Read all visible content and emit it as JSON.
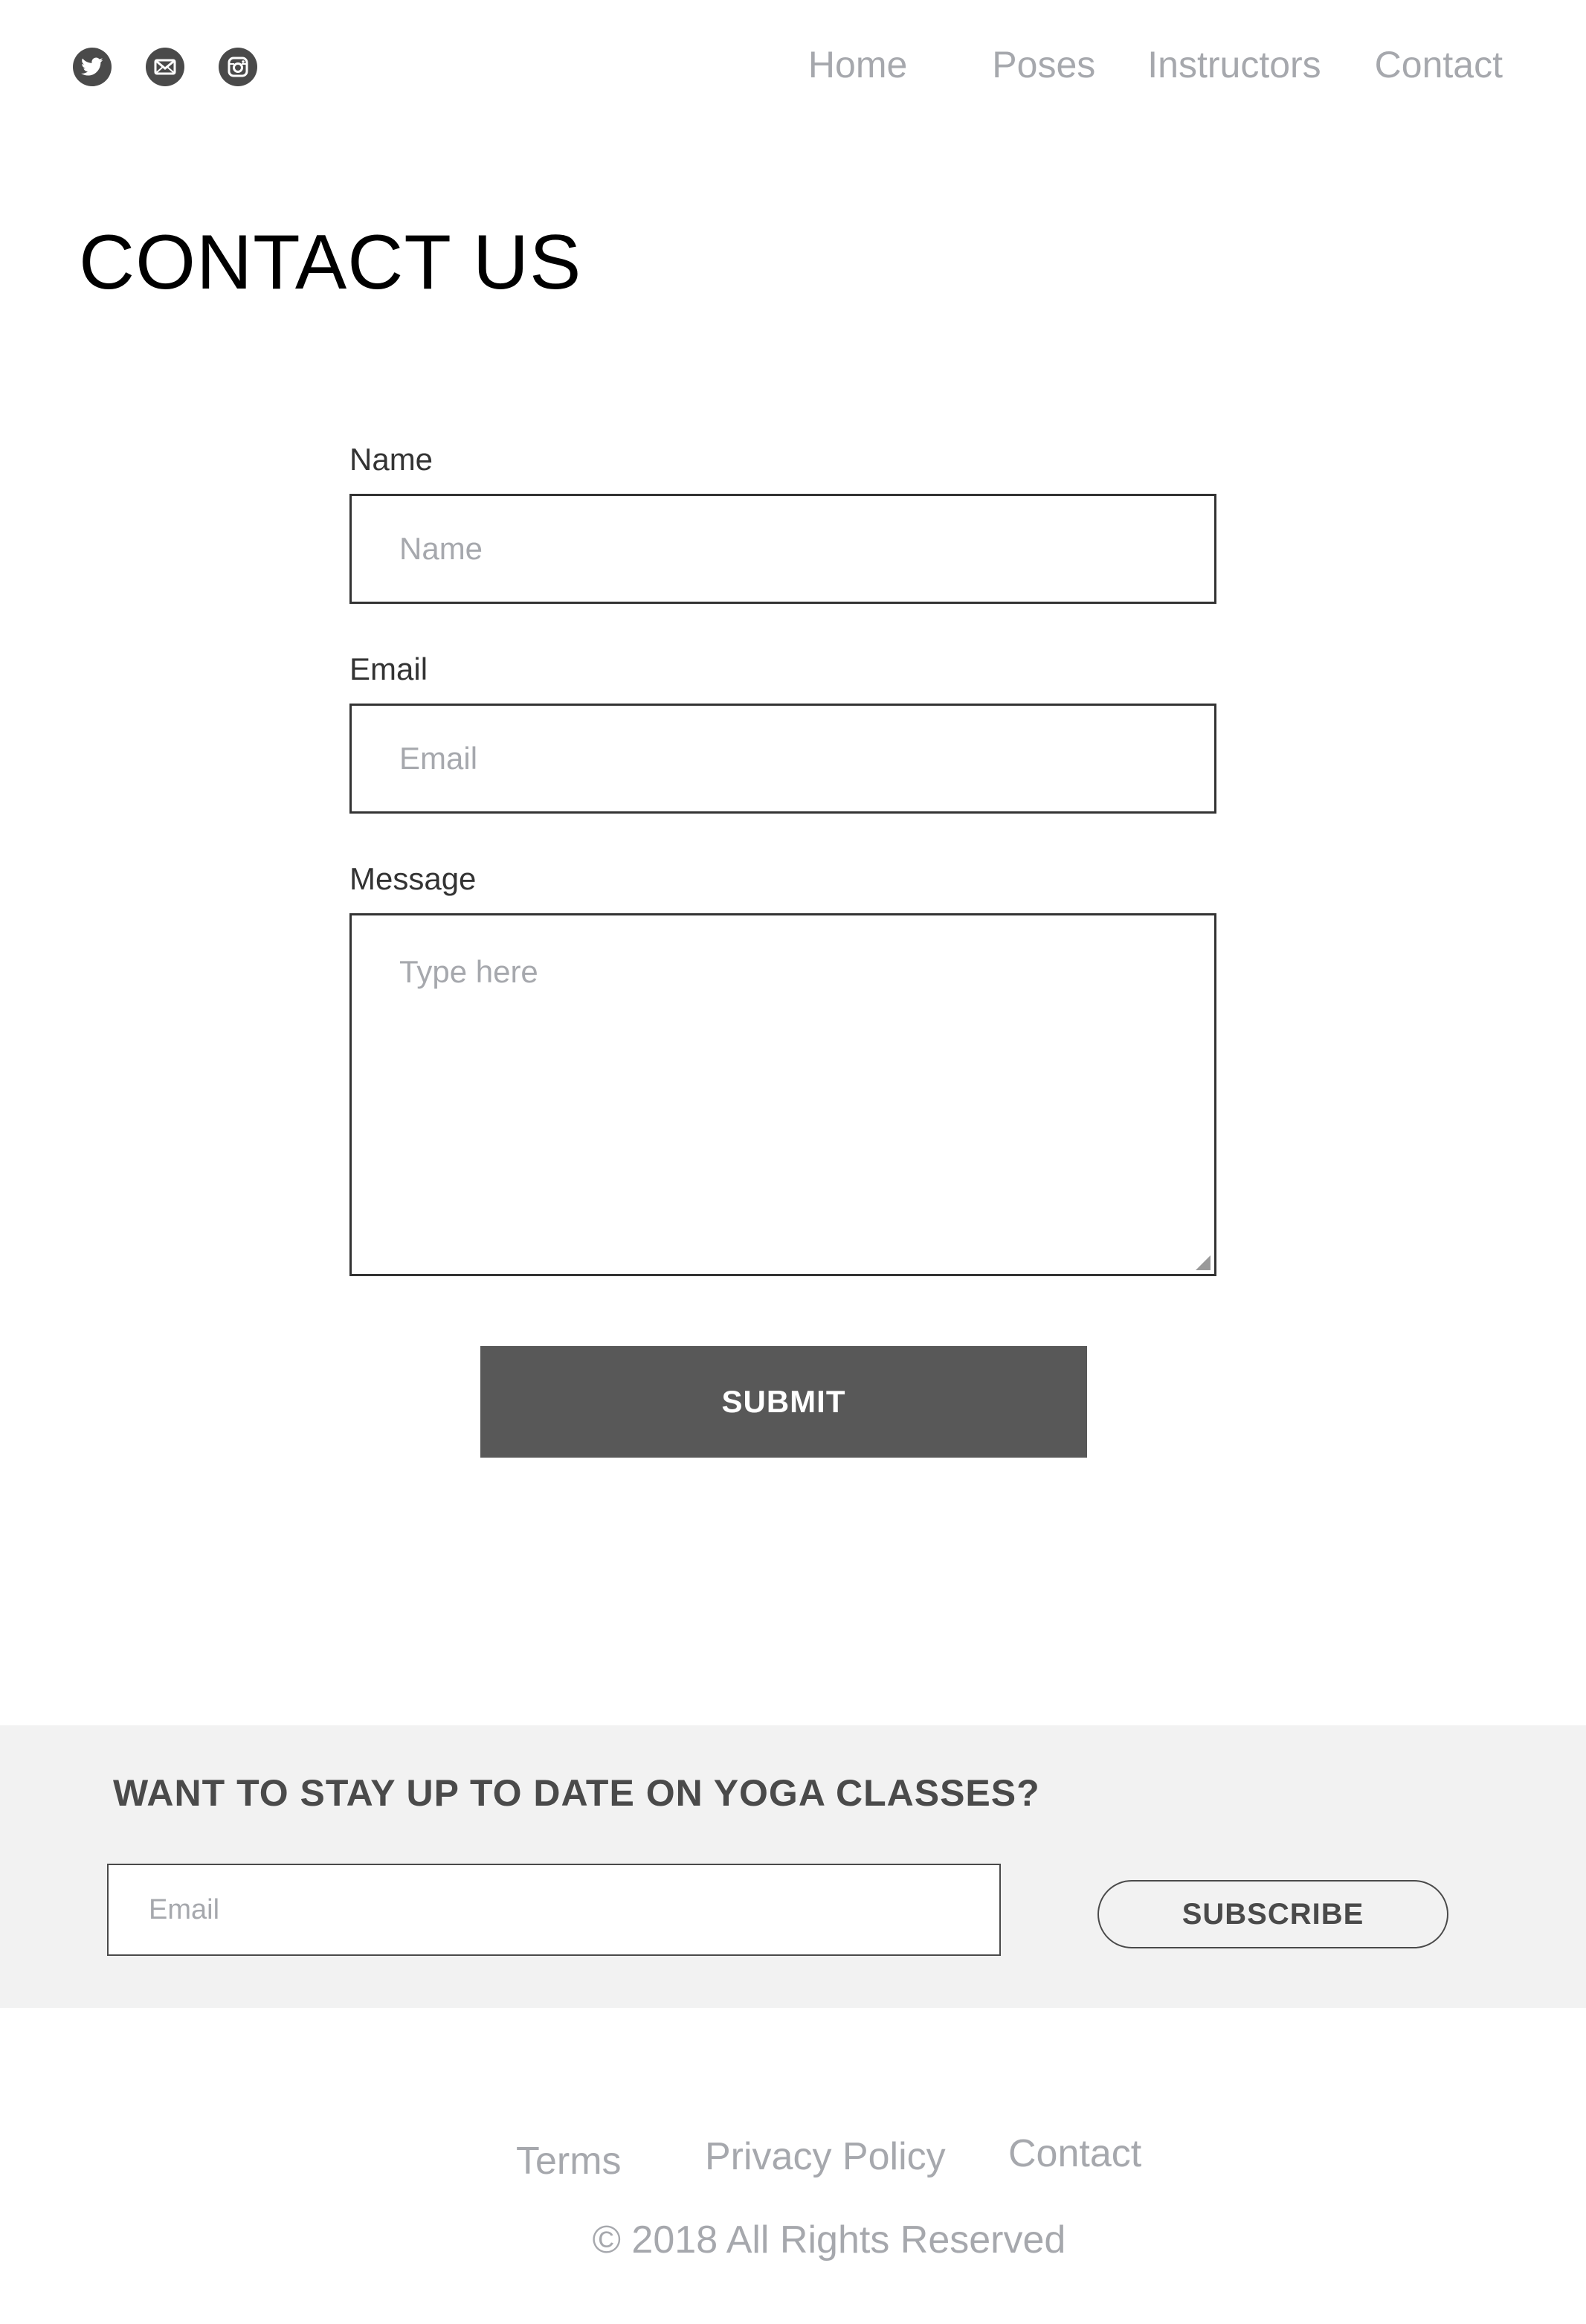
{
  "social": {
    "icons": [
      "twitter-icon",
      "mail-icon",
      "instagram-icon"
    ]
  },
  "nav": {
    "home": "Home",
    "poses": "Poses",
    "instructors": "Instructors",
    "contact": "Contact"
  },
  "page": {
    "title": "CONTACT US"
  },
  "form": {
    "name_label": "Name",
    "name_placeholder": "Name",
    "name_value": "",
    "email_label": "Email",
    "email_placeholder": "Email",
    "email_value": "",
    "message_label": "Message",
    "message_placeholder": "Type here",
    "message_value": "",
    "submit_label": "SUBMIT"
  },
  "newsletter": {
    "title": "WANT TO STAY UP TO DATE ON YOGA CLASSES?",
    "email_placeholder": "Email",
    "email_value": "",
    "subscribe_label": "SUBSCRIBE"
  },
  "footer": {
    "terms": "Terms",
    "privacy": "Privacy Policy",
    "contact": "Contact",
    "copyright": "© 2018 All Rights Reserved"
  },
  "colors": {
    "text_dark": "#333333",
    "text_muted": "#a6a8ad",
    "button_dark": "#585858",
    "band_background": "#f2f2f2"
  }
}
